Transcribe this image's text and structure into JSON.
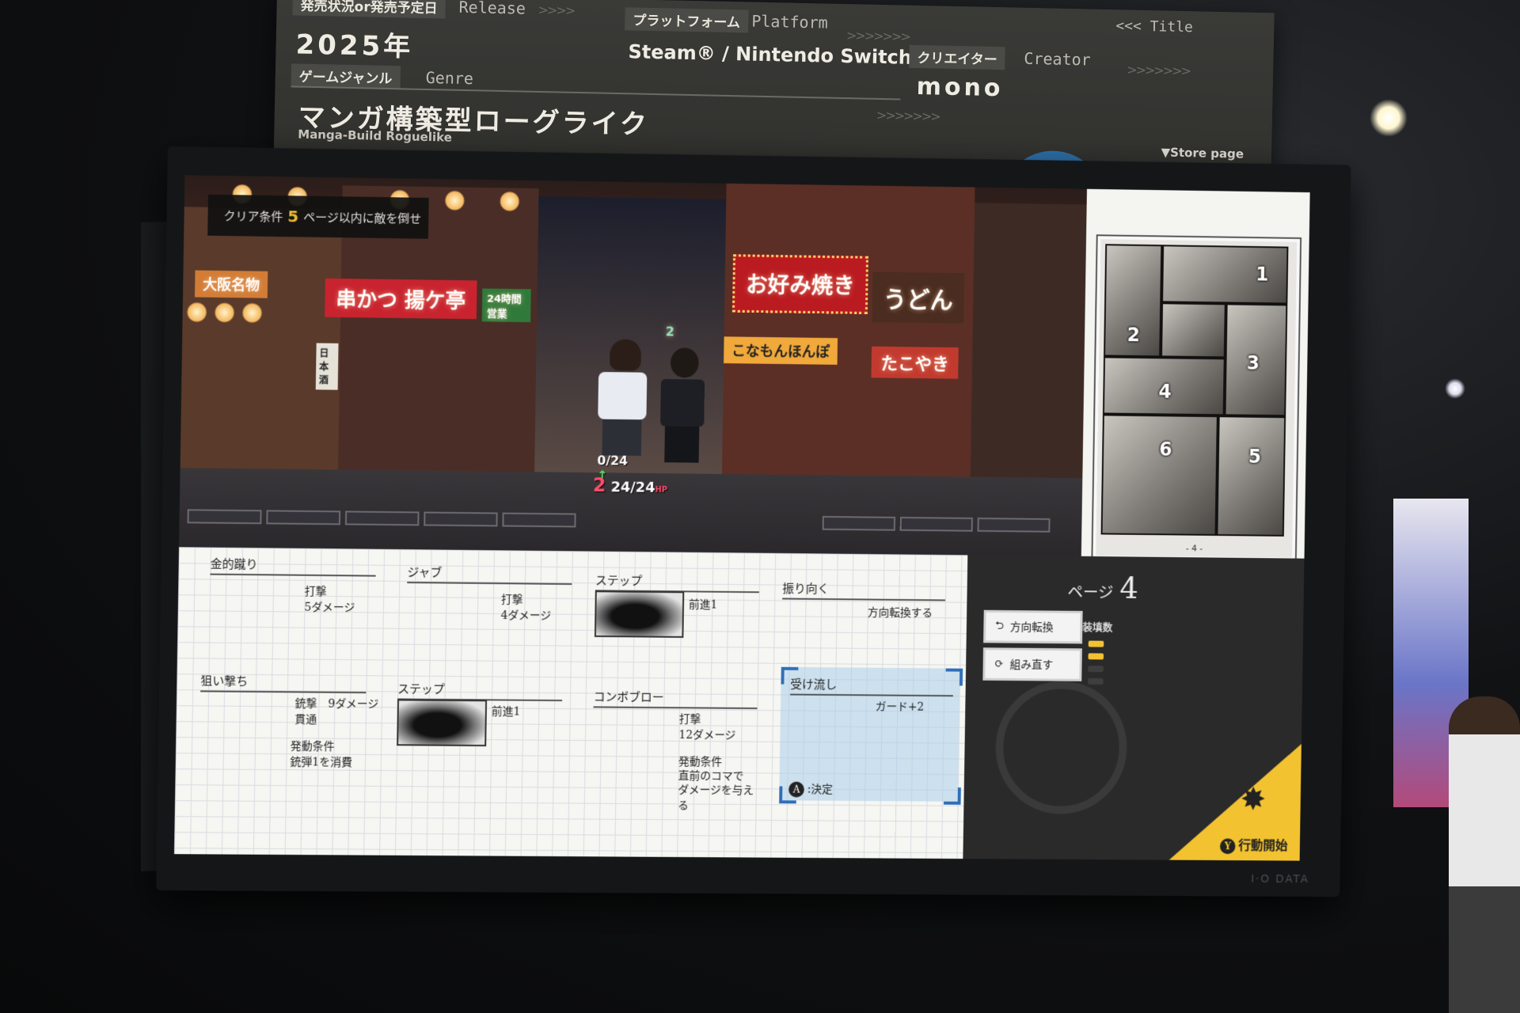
{
  "sign": {
    "release_jp": "発売状況or発売予定日",
    "release_en": "Release",
    "release_value": "2025年",
    "platform_jp": "プラットフォーム",
    "platform_en": "Platform",
    "platform_value": "Steam® / Nintendo Switch™",
    "creator_jp": "クリエイター",
    "creator_en": "Creator",
    "creator_value": "mono",
    "genre_jp": "ゲームジャンル",
    "genre_en": "Genre",
    "genre_value": "マンガ構築型ローグライク",
    "genre_sub": "Manga-Build Roguelike",
    "title_link": "<<< Title",
    "store_page": "▼Store page",
    "camera_icon": "camera-phone-icon"
  },
  "scene": {
    "clear_label": "クリア条件",
    "clear_num": "5",
    "clear_text": "ページ以内に敵を倒せ",
    "shop_signs": [
      "串かつ 揚ケ亭",
      "24時間営業",
      "大阪名物",
      "お好み焼き",
      "うどん",
      "こなもんほんぽ",
      "たこやき",
      "日本酒"
    ],
    "enemy_counter": "2",
    "player_hits": "0/24",
    "hp_prefix": "2",
    "hp_value": "24/24",
    "hp_label": "HP"
  },
  "manga": {
    "panel_numbers": [
      "1",
      "2",
      "3",
      "4",
      "5",
      "6"
    ],
    "page_footer": "- 4 -"
  },
  "cards": [
    {
      "title": "金的蹴り",
      "lines": [
        "打撃",
        "5ダメージ"
      ]
    },
    {
      "title": "ジャブ",
      "lines": [
        "打撃",
        "4ダメージ"
      ]
    },
    {
      "title": "ステップ",
      "lines": [
        "前進1"
      ]
    },
    {
      "title": "振り向く",
      "lines": [
        "方向転換する"
      ]
    },
    {
      "title": "狙い撃ち",
      "lines": [
        "銃撃　9ダメージ",
        "貫通",
        "発動条件",
        "銃弾1を消費"
      ]
    },
    {
      "title": "ステップ",
      "lines": [
        "前進1"
      ]
    },
    {
      "title": "コンボブロー",
      "lines": [
        "打撃",
        "12ダメージ",
        "発動条件",
        "直前のコマで",
        "ダメージを与える"
      ]
    },
    {
      "title": "受け流し",
      "lines": [
        "ガード+2"
      ]
    }
  ],
  "confirm": {
    "button": "A",
    "label": ":決定"
  },
  "side": {
    "page_label": "ページ",
    "page_number": "4",
    "btn_turn": "方向転換",
    "btn_rebuild": "組み直す",
    "ammo_label": "装填数",
    "ammo_loaded": 2,
    "ammo_total": 4,
    "action_button": "Y",
    "action_label": "行動開始"
  },
  "monitor_brand": "I·O DATA",
  "colors": {
    "accent_yellow": "#f2c230",
    "hp_red": "#ff4d6d",
    "select_blue": "#2f6fb8"
  }
}
